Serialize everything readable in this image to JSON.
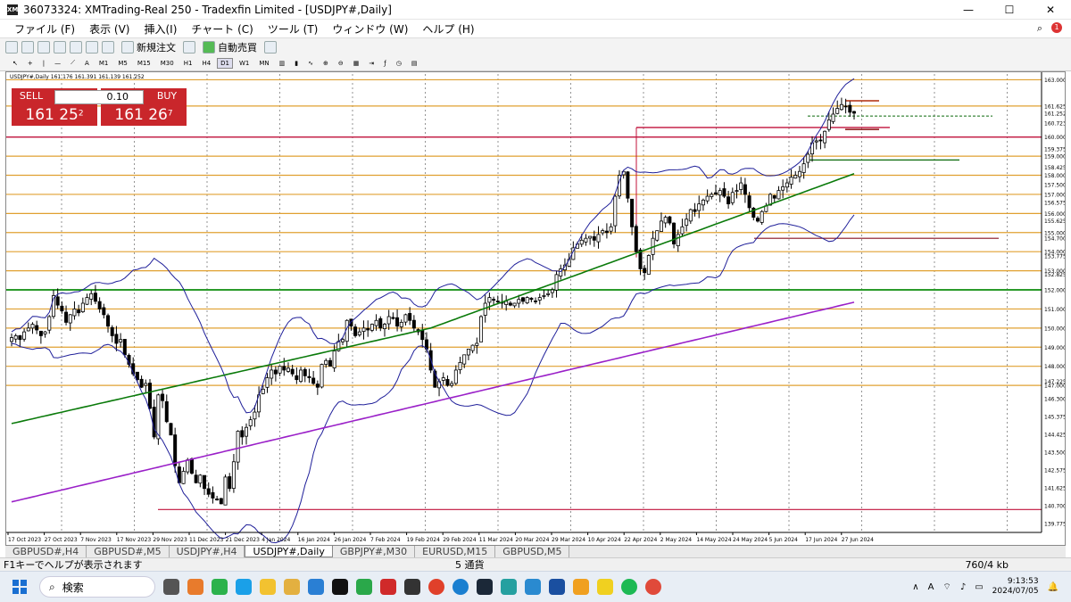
{
  "window": {
    "title": "36073324: XMTrading-Real 250 - Tradexfin Limited - [USDJPY#,Daily]",
    "min_glyph": "—",
    "max_glyph": "☐",
    "close_glyph": "✕"
  },
  "menu": {
    "items": [
      "ファイル (F)",
      "表示 (V)",
      "挿入(I)",
      "チャート (C)",
      "ツール (T)",
      "ウィンドウ (W)",
      "ヘルプ (H)"
    ],
    "notification_count": "1"
  },
  "toolbar": {
    "new_order": "新規注文",
    "auto_trade": "自動売買"
  },
  "timeframes": [
    "M1",
    "M5",
    "M15",
    "M30",
    "H1",
    "H4",
    "D1",
    "W1",
    "MN"
  ],
  "active_timeframe": "D1",
  "chart_header": "USDJPY#,Daily  161.176 161.391 161.139 161.252",
  "trade_panel": {
    "sell_label": "SELL",
    "buy_label": "BUY",
    "lot": "0.10",
    "sell_price_big": "161 25",
    "sell_price_sup": "2",
    "buy_price_big": "161 26",
    "buy_price_sup": "7"
  },
  "colors": {
    "bull": "#ffffff",
    "bear": "#000000",
    "orange_level": "#e0a030",
    "red_level": "#c0103a",
    "green_level": "#2a9a2a",
    "bollinger": "#20209a",
    "ma_green": "#0a7a0a",
    "ma_purple": "#9a20c8"
  },
  "chart_data": {
    "type": "candlestick",
    "symbol": "USDJPY#",
    "timeframe": "Daily",
    "ylim": [
      139.3,
      163.3
    ],
    "price_labels": [
      "163.000",
      "161.625",
      "161.252",
      "160.723",
      "160.000",
      "159.375",
      "159.000",
      "158.425",
      "158.000",
      "157.500",
      "157.000",
      "156.575",
      "156.000",
      "155.625",
      "155.000",
      "154.700",
      "154.000",
      "153.775",
      "153.000",
      "152.825",
      "152.000",
      "151.000",
      "150.000",
      "149.000",
      "148.000",
      "147.225",
      "147.000",
      "146.300",
      "145.375",
      "144.425",
      "143.500",
      "142.575",
      "141.625",
      "140.700",
      "139.775"
    ],
    "x_labels": [
      "17 Oct 2023",
      "27 Oct 2023",
      "7 Nov 2023",
      "17 Nov 2023",
      "29 Nov 2023",
      "11 Dec 2023",
      "21 Dec 2023",
      "4 Jan 2024",
      "16 Jan 2024",
      "26 Jan 2024",
      "7 Feb 2024",
      "19 Feb 2024",
      "29 Feb 2024",
      "11 Mar 2024",
      "20 Mar 2024",
      "29 Mar 2024",
      "10 Apr 2024",
      "22 Apr 2024",
      "2 May 2024",
      "14 May 2024",
      "24 May 2024",
      "5 Jun 2024",
      "17 Jun 2024",
      "27 Jun 2024"
    ],
    "orange_levels": [
      163.0,
      161.625,
      159.0,
      158.0,
      157.0,
      156.0,
      155.0,
      154.0,
      153.0,
      152.0,
      151.0,
      150.0,
      149.0,
      148.0,
      147.0
    ],
    "red_levels": [
      160.5,
      160.0,
      140.5
    ],
    "green_level": 152.0,
    "close_path": [
      149.5,
      149.6,
      149.4,
      149.8,
      150.0,
      150.2,
      149.9,
      149.6,
      149.8,
      150.6,
      151.7,
      151.2,
      150.9,
      150.3,
      150.7,
      151.0,
      150.8,
      151.3,
      151.6,
      151.8,
      151.4,
      151.0,
      150.7,
      150.1,
      149.6,
      149.2,
      149.4,
      148.6,
      148.1,
      147.6,
      147.3,
      146.9,
      147.1,
      145.8,
      144.3,
      146.5,
      146.2,
      145.1,
      144.4,
      142.8,
      141.9,
      142.5,
      143.1,
      142.4,
      141.9,
      142.3,
      141.6,
      141.3,
      141.1,
      141.0,
      140.8,
      142.2,
      141.6,
      143.0,
      144.6,
      144.3,
      144.8,
      145.2,
      145.6,
      146.5,
      146.8,
      147.4,
      147.8,
      147.6,
      148.0,
      147.8,
      147.9,
      147.6,
      147.3,
      147.8,
      147.5,
      147.4,
      147.1,
      146.9,
      148.1,
      148.3,
      148.0,
      148.8,
      149.3,
      149.4,
      150.4,
      150.1,
      149.6,
      149.8,
      150.0,
      149.9,
      150.2,
      150.4,
      150.0,
      150.2,
      150.6,
      150.5,
      150.1,
      150.3,
      150.7,
      150.4,
      150.0,
      149.8,
      149.4,
      148.9,
      147.8,
      146.9,
      147.2,
      147.4,
      147.0,
      147.1,
      147.8,
      148.2,
      148.6,
      148.9,
      149.1,
      149.2,
      150.6,
      151.3,
      151.6,
      151.5,
      151.4,
      151.3,
      151.4,
      151.2,
      151.3,
      151.5,
      151.4,
      151.6,
      151.5,
      151.4,
      151.6,
      151.7,
      151.8,
      152.0,
      152.8,
      153.1,
      153.3,
      153.6,
      154.2,
      154.4,
      154.6,
      154.7,
      154.8,
      154.6,
      154.9,
      155.1,
      155.0,
      155.3,
      156.9,
      158.0,
      158.2,
      156.8,
      155.3,
      154.0,
      153.1,
      152.9,
      153.8,
      154.7,
      155.1,
      155.6,
      155.8,
      155.5,
      154.4,
      154.9,
      155.3,
      155.7,
      156.2,
      156.1,
      156.5,
      156.7,
      156.9,
      157.0,
      157.0,
      157.2,
      156.9,
      156.5,
      157.1,
      157.2,
      157.6,
      157.0,
      156.3,
      155.8,
      155.6,
      156.1,
      156.4,
      157.0,
      156.8,
      157.2,
      157.4,
      157.6,
      157.9,
      158.0,
      158.2,
      158.6,
      159.1,
      159.7,
      159.8,
      159.8,
      160.3,
      160.9,
      161.2,
      161.5,
      161.7,
      161.6,
      161.3,
      161.25
    ]
  },
  "tabs": [
    "GBPUSD#,H4",
    "GBPUSD#,M5",
    "USDJPY#,H4",
    "USDJPY#,Daily",
    "GBPJPY#,M30",
    "EURUSD,M15",
    "GBPUSD,M5"
  ],
  "active_tab": "USDJPY#,Daily",
  "statusbar": {
    "help": "F1キーでヘルプが表示されます",
    "currency": "5 通貨",
    "kb": "760/4 kb"
  },
  "taskbar": {
    "search": "検索",
    "time": "9:13:53",
    "date": "2024/07/05",
    "ime": "A"
  }
}
